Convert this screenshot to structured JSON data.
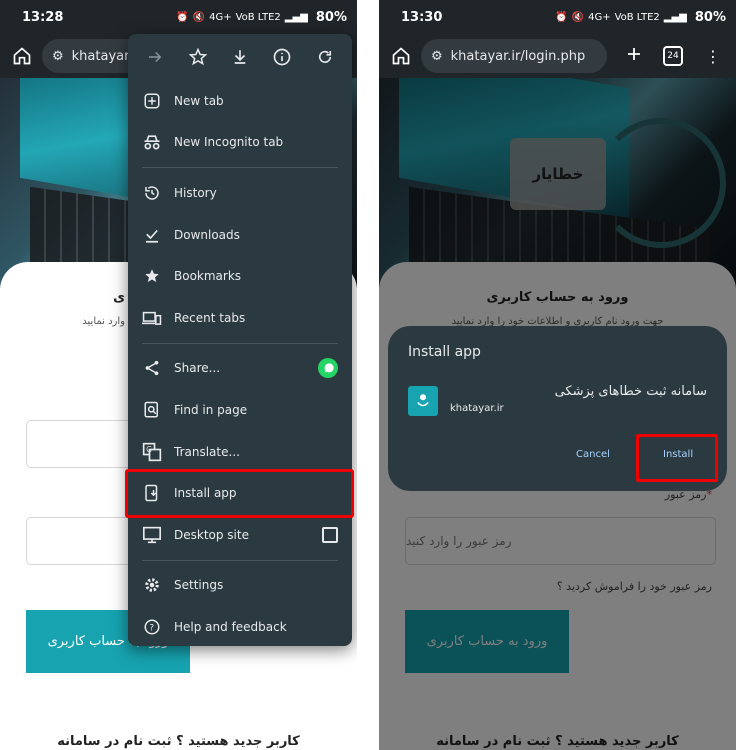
{
  "left": {
    "status": {
      "time": "13:28",
      "network": "VoB LTE2",
      "signal": "4G+",
      "battery": "80%"
    },
    "url": "khatayar.ir/",
    "page": {
      "title_fragment": "ی",
      "subtitle_fragment": "وارد نمایید",
      "login_button": "ورود به حساب کاربری",
      "register": "کاربر جدید هستید ؟ ثبت نام در سامانه"
    },
    "menu": {
      "top_icons": [
        "forward-icon",
        "star-icon",
        "download-icon",
        "info-icon",
        "refresh-icon"
      ],
      "items": [
        {
          "label": "New tab",
          "icon": "plus-box-icon"
        },
        {
          "label": "New Incognito tab",
          "icon": "incognito-icon"
        },
        {
          "label": "History",
          "icon": "history-icon"
        },
        {
          "label": "Downloads",
          "icon": "check-download-icon"
        },
        {
          "label": "Bookmarks",
          "icon": "star-filled-icon"
        },
        {
          "label": "Recent tabs",
          "icon": "devices-icon"
        },
        {
          "label": "Share...",
          "icon": "share-icon",
          "trailing": "whatsapp-icon"
        },
        {
          "label": "Find in page",
          "icon": "find-icon"
        },
        {
          "label": "Translate...",
          "icon": "translate-icon"
        },
        {
          "label": "Install app",
          "icon": "install-icon"
        },
        {
          "label": "Desktop site",
          "icon": "monitor-icon",
          "trailing": "checkbox-unchecked"
        },
        {
          "label": "Settings",
          "icon": "gear-icon"
        },
        {
          "label": "Help and feedback",
          "icon": "help-icon"
        }
      ]
    }
  },
  "right": {
    "status": {
      "time": "13:30",
      "network": "VoB LTE2",
      "signal": "4G+",
      "battery": "80%"
    },
    "url": "khatayar.ir/login.php",
    "tab_count": "24",
    "page": {
      "logo_text": "خطایار",
      "title": "ورود به حساب کاربری",
      "subtitle": "جهت ورود نام کاربری و اطلاعات خود را وارد نمایید",
      "password_label": "رمز عبور",
      "password_placeholder": "رمز عبور را وارد کنید",
      "forgot": "رمز عبور خود را فراموش کردید ؟",
      "login_button": "ورود به حساب کاربری",
      "register": "کاربر جدید هستید ؟ ثبت نام در سامانه"
    },
    "dialog": {
      "title": "Install app",
      "app_name": "سامانه ثبت خطاهای پزشکی",
      "domain": "khatayar.ir",
      "cancel": "Cancel",
      "install": "Install"
    }
  },
  "colors": {
    "chrome_dark": "#1f2529",
    "menu_bg": "#2b3a40",
    "accent_teal": "#17a3b0",
    "highlight_red": "#e00000",
    "link_blue": "#a6d2ff"
  }
}
